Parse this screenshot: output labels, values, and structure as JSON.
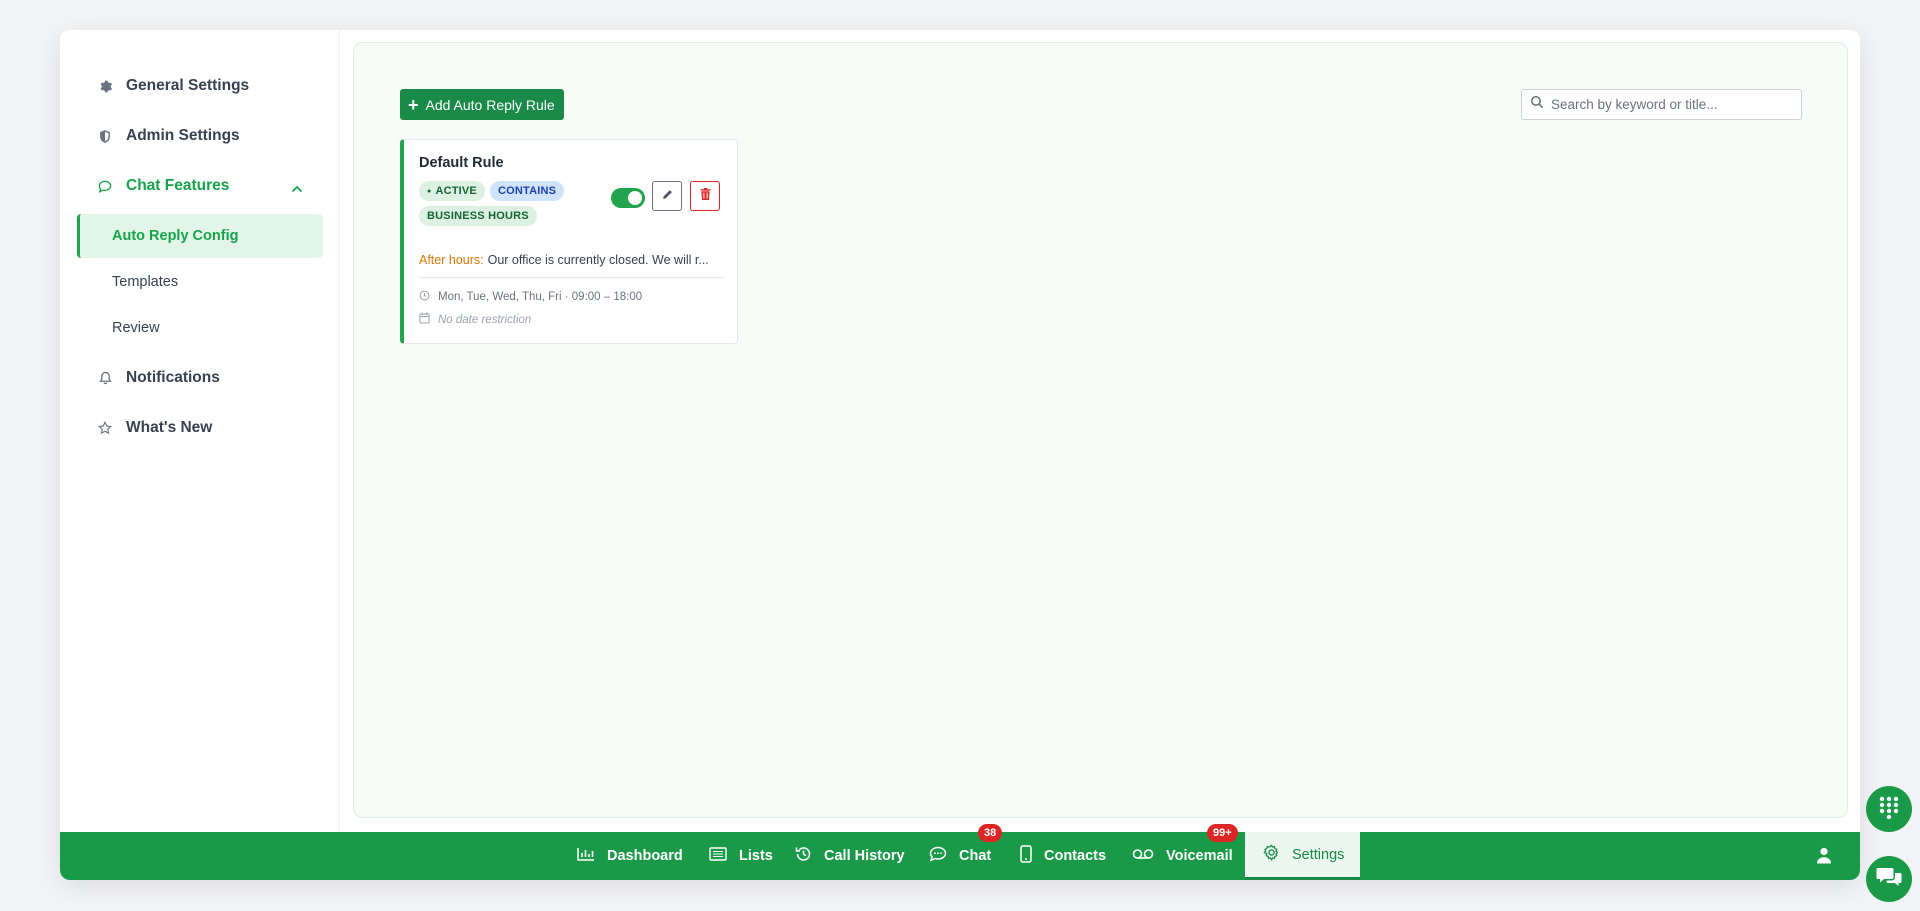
{
  "sidebar": {
    "items": [
      {
        "label": "General Settings",
        "icon": "gear-icon"
      },
      {
        "label": "Admin Settings",
        "icon": "shield-icon"
      },
      {
        "label": "Chat Features",
        "icon": "chat-bubble-icon",
        "expanded": true
      },
      {
        "label": "Notifications",
        "icon": "bell-icon"
      },
      {
        "label": "What's New",
        "icon": "star-icon"
      }
    ],
    "sub_items": [
      {
        "label": "Auto Reply Config",
        "active": true
      },
      {
        "label": "Templates"
      },
      {
        "label": "Review"
      }
    ]
  },
  "main": {
    "add_button_label": "Add Auto Reply Rule",
    "search_placeholder": "Search by keyword or title...",
    "search_value": "",
    "rule_card": {
      "title": "Default Rule",
      "tags": [
        "ACTIVE",
        "CONTAINS",
        "BUSINESS HOURS"
      ],
      "enabled": true,
      "after_hours_label": "After hours:",
      "after_hours_text": "Our office is currently closed. We will r...",
      "schedule": "Mon, Tue, Wed, Thu, Fri · 09:00 – 18:00",
      "date_restriction": "No date restriction"
    }
  },
  "bottom_nav": {
    "items": [
      {
        "label": "Dashboard",
        "icon": "bar-chart-icon"
      },
      {
        "label": "Lists",
        "icon": "list-icon"
      },
      {
        "label": "Call History",
        "icon": "history-icon"
      },
      {
        "label": "Chat",
        "icon": "chat-icon",
        "badge": "38"
      },
      {
        "label": "Contacts",
        "icon": "phone-icon"
      },
      {
        "label": "Voicemail",
        "icon": "voicemail-icon",
        "badge": "99+"
      },
      {
        "label": "Settings",
        "icon": "gear-icon",
        "active": true
      }
    ]
  },
  "colors": {
    "brand_green": "#1a9a49",
    "active_bg": "#e3f5e8",
    "badge_red": "#dc2626",
    "after_hours_orange": "#d97706",
    "delete_red": "#dc2626"
  }
}
